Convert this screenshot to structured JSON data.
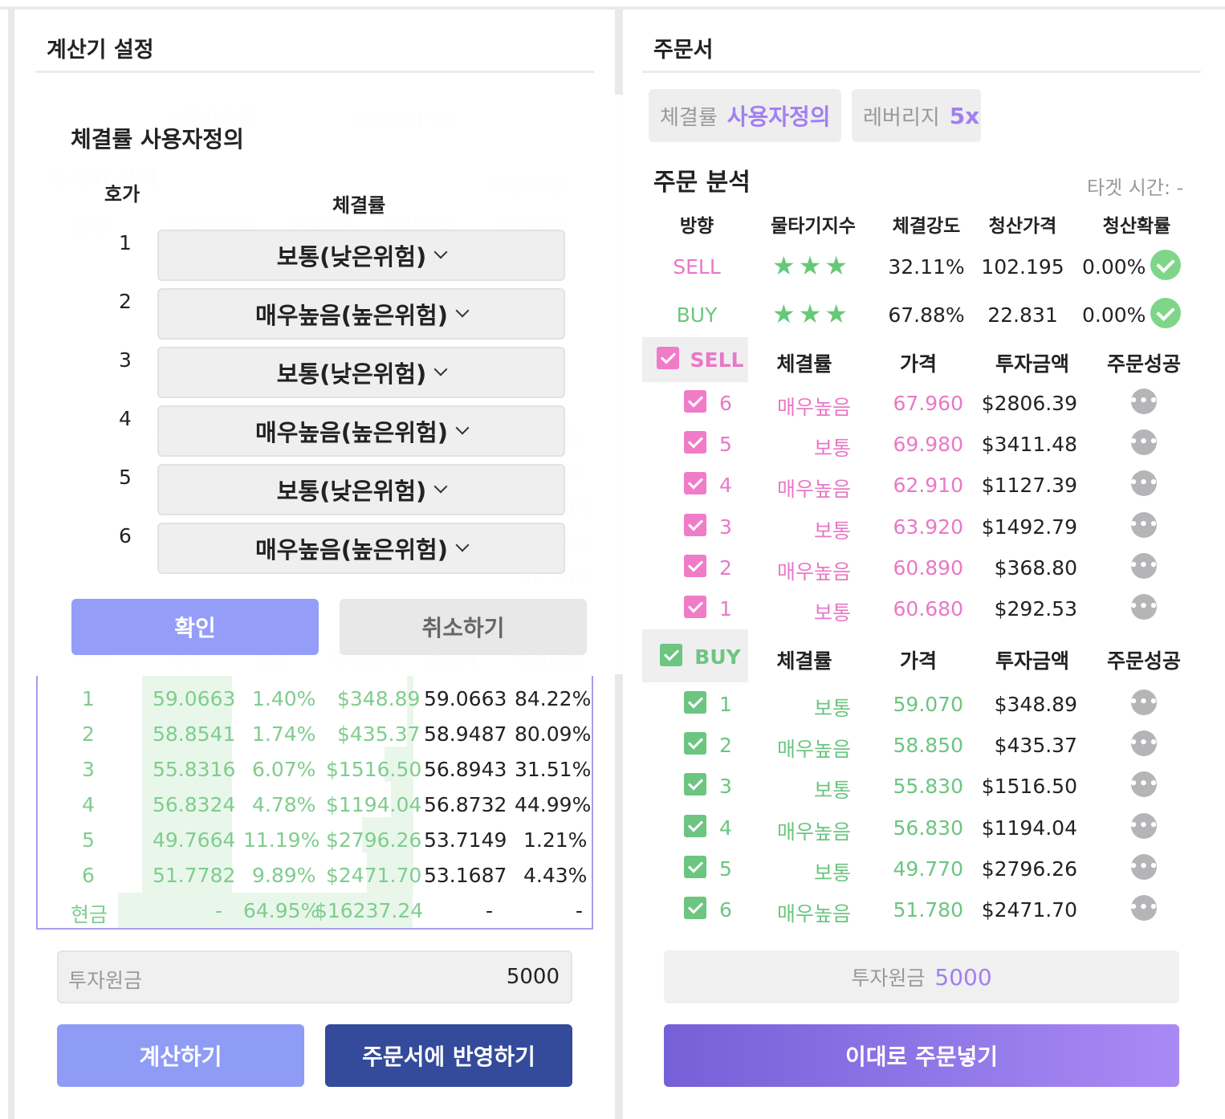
{
  "calculator": {
    "title": "계산기 설정",
    "modal": {
      "title": "체결률 사용자정의",
      "col_hoga": "호가",
      "col_rate": "체결률",
      "rows": [
        {
          "num": "1",
          "value": "보통(낮은위험)"
        },
        {
          "num": "2",
          "value": "매우높음(높은위험)"
        },
        {
          "num": "3",
          "value": "보통(낮은위험)"
        },
        {
          "num": "4",
          "value": "매우높음(높은위험)"
        },
        {
          "num": "5",
          "value": "보통(낮은위험)"
        },
        {
          "num": "6",
          "value": "매우높음(높은위험)"
        }
      ],
      "confirm": "확인",
      "cancel": "취소하기"
    },
    "buy_rows": [
      {
        "num": "1",
        "price": "59.0663",
        "weight": "1.40%",
        "amount": "$348.89",
        "avg": "59.0663",
        "prob": "84.22%"
      },
      {
        "num": "2",
        "price": "58.8541",
        "weight": "1.74%",
        "amount": "$435.37",
        "avg": "58.9487",
        "prob": "80.09%"
      },
      {
        "num": "3",
        "price": "55.8316",
        "weight": "6.07%",
        "amount": "$1516.50",
        "avg": "56.8943",
        "prob": "31.51%"
      },
      {
        "num": "4",
        "price": "56.8324",
        "weight": "4.78%",
        "amount": "$1194.04",
        "avg": "56.8732",
        "prob": "44.99%"
      },
      {
        "num": "5",
        "price": "49.7664",
        "weight": "11.19%",
        "amount": "$2796.26",
        "avg": "53.7149",
        "prob": "1.21%"
      },
      {
        "num": "6",
        "price": "51.7782",
        "weight": "9.89%",
        "amount": "$2471.70",
        "avg": "53.1687",
        "prob": "4.43%"
      },
      {
        "num": "현금",
        "price": "-",
        "weight": "64.95%",
        "amount": "$16237.24",
        "avg": "-",
        "prob": "-"
      }
    ],
    "principal_label": "투자원금",
    "principal_value": "5000",
    "calc_button": "계산하기",
    "apply_button": "주문서에 반영하기"
  },
  "order": {
    "title": "주문서",
    "rate_label": "체결률",
    "rate_value": "사용자정의",
    "leverage_label": "레버리지",
    "leverage_value": "5x",
    "analysis_title": "주문 분석",
    "target_time": "타겟 시간: -",
    "analysis_headers": [
      "방향",
      "물타기지수",
      "체결강도",
      "청산가격",
      "청산확률"
    ],
    "analysis_rows": [
      {
        "direction": "SELL",
        "stars": "★★★",
        "strength": "32.11%",
        "liq_price": "102.195",
        "liq_prob": "0.00%"
      },
      {
        "direction": "BUY",
        "stars": "★★★",
        "strength": "67.88%",
        "liq_price": "22.831",
        "liq_prob": "0.00%"
      }
    ],
    "group_headers": [
      "체결률",
      "가격",
      "투자금액",
      "주문성공"
    ],
    "sell_label": "SELL",
    "buy_label": "BUY",
    "sell_rows": [
      {
        "num": "6",
        "rate": "매우높음",
        "price": "67.960",
        "amount": "$2806.39"
      },
      {
        "num": "5",
        "rate": "보통",
        "price": "69.980",
        "amount": "$3411.48"
      },
      {
        "num": "4",
        "rate": "매우높음",
        "price": "62.910",
        "amount": "$1127.39"
      },
      {
        "num": "3",
        "rate": "보통",
        "price": "63.920",
        "amount": "$1492.79"
      },
      {
        "num": "2",
        "rate": "매우높음",
        "price": "60.890",
        "amount": "$368.80"
      },
      {
        "num": "1",
        "rate": "보통",
        "price": "60.680",
        "amount": "$292.53"
      }
    ],
    "buy_rows": [
      {
        "num": "1",
        "rate": "보통",
        "price": "59.070",
        "amount": "$348.89"
      },
      {
        "num": "2",
        "rate": "매우높음",
        "price": "58.850",
        "amount": "$435.37"
      },
      {
        "num": "3",
        "rate": "보통",
        "price": "55.830",
        "amount": "$1516.50"
      },
      {
        "num": "4",
        "rate": "매우높음",
        "price": "56.830",
        "amount": "$1194.04"
      },
      {
        "num": "5",
        "rate": "보통",
        "price": "49.770",
        "amount": "$2796.26"
      },
      {
        "num": "6",
        "rate": "매우높음",
        "price": "51.780",
        "amount": "$2471.70"
      }
    ],
    "principal_label": "투자원금",
    "principal_value": "5000",
    "submit_button": "이대로 주문넣기"
  },
  "colors": {
    "sell": "#e879c6",
    "buy": "#6cc580",
    "accent": "#a17ff0",
    "navy": "#344a9a",
    "periwinkle": "#8f9cf5"
  }
}
